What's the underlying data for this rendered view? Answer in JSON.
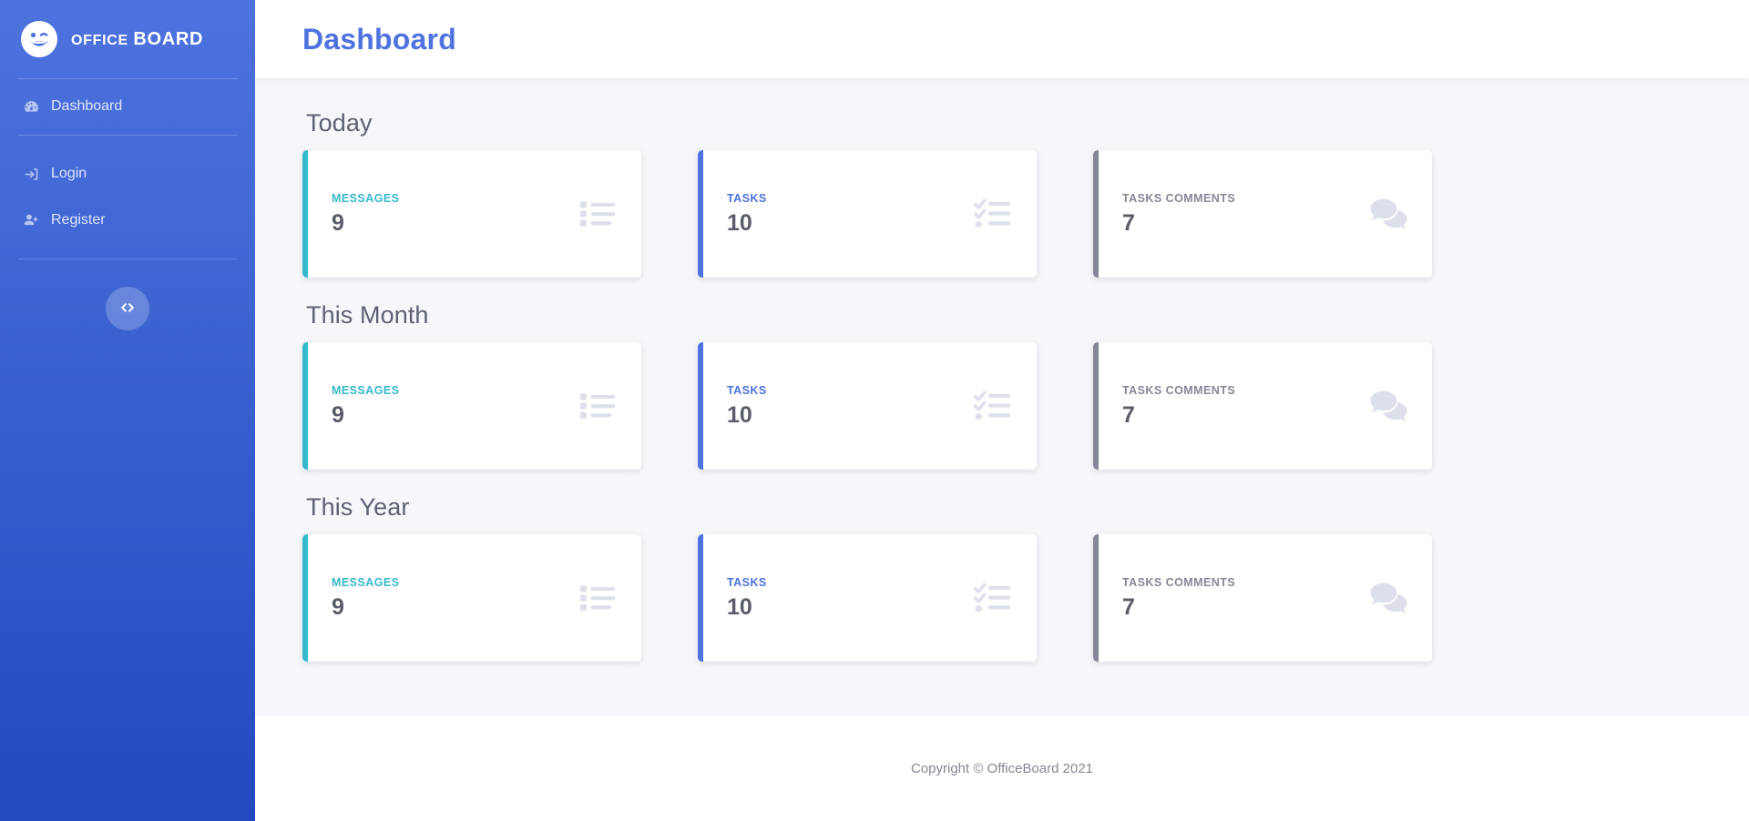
{
  "brand": {
    "logo_icon": "smiley-wink-icon",
    "name_thin": "OFFICE",
    "name_bold": "BOARD"
  },
  "sidebar": {
    "items": [
      {
        "label": "Dashboard",
        "icon": "tachometer-icon",
        "name": "sidebar-item-dashboard"
      },
      {
        "label": "Login",
        "icon": "sign-in-icon",
        "name": "sidebar-item-login"
      },
      {
        "label": "Register",
        "icon": "user-plus-icon",
        "name": "sidebar-item-register"
      }
    ],
    "toggle": {
      "icon": "code-icon",
      "label": "<>"
    }
  },
  "header": {
    "title": "Dashboard"
  },
  "colors": {
    "brand_blue": "#4e73df",
    "brand_blue_dark": "#224abe",
    "teal": "#36b9cc",
    "gray": "#858796",
    "value_text": "#5a5c69",
    "icon_fill": "#dddfeb",
    "content_bg": "#f6f7fb"
  },
  "main": {
    "sections": [
      {
        "title": "Today",
        "cards": [
          {
            "label": "MESSAGES",
            "value": "9",
            "accent": "teal",
            "icon": "list-ul-icon",
            "color": "#36b9cc"
          },
          {
            "label": "TASKS",
            "value": "10",
            "accent": "blue",
            "icon": "tasks-icon",
            "color": "#4e73df"
          },
          {
            "label": "TASKS COMMENTS",
            "value": "7",
            "accent": "gray",
            "icon": "comments-icon",
            "color": "#858796"
          }
        ]
      },
      {
        "title": "This Month",
        "cards": [
          {
            "label": "MESSAGES",
            "value": "9",
            "accent": "teal",
            "icon": "list-ul-icon",
            "color": "#36b9cc"
          },
          {
            "label": "TASKS",
            "value": "10",
            "accent": "blue",
            "icon": "tasks-icon",
            "color": "#4e73df"
          },
          {
            "label": "TASKS COMMENTS",
            "value": "7",
            "accent": "gray",
            "icon": "comments-icon",
            "color": "#858796"
          }
        ]
      },
      {
        "title": "This Year",
        "cards": [
          {
            "label": "MESSAGES",
            "value": "9",
            "accent": "teal",
            "icon": "list-ul-icon",
            "color": "#36b9cc"
          },
          {
            "label": "TASKS",
            "value": "10",
            "accent": "blue",
            "icon": "tasks-icon",
            "color": "#4e73df"
          },
          {
            "label": "TASKS COMMENTS",
            "value": "7",
            "accent": "gray",
            "icon": "comments-icon",
            "color": "#858796"
          }
        ]
      }
    ]
  },
  "footer": {
    "copyright": "Copyright © OfficeBoard 2021"
  }
}
